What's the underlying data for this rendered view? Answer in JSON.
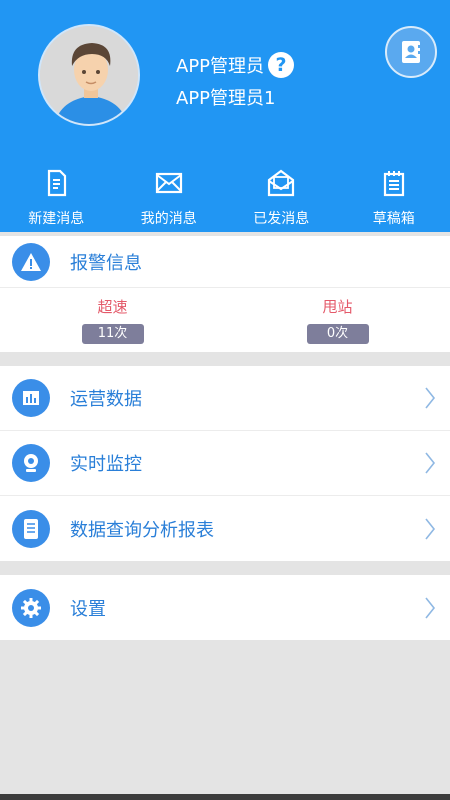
{
  "user": {
    "name_primary": "APP管理员",
    "name_secondary": "APP管理员1"
  },
  "quick_actions": [
    {
      "label": "新建消息",
      "icon": "new-message-icon"
    },
    {
      "label": "我的消息",
      "icon": "envelope-icon"
    },
    {
      "label": "已发消息",
      "icon": "sent-mail-icon"
    },
    {
      "label": "草稿箱",
      "icon": "draft-notepad-icon"
    }
  ],
  "alarm": {
    "title": "报警信息",
    "stats": [
      {
        "label": "超速",
        "count": "11次"
      },
      {
        "label": "甩站",
        "count": "0次"
      }
    ]
  },
  "menu": [
    {
      "label": "运营数据",
      "icon": "bar-chart-icon"
    },
    {
      "label": "实时监控",
      "icon": "webcam-icon"
    },
    {
      "label": "数据查询分析报表",
      "icon": "report-icon"
    }
  ],
  "settings": {
    "label": "设置",
    "icon": "gear-icon"
  },
  "colors": {
    "primary": "#2196f3",
    "accent_blue": "#3a8ee8",
    "alarm_red": "#e45a6a",
    "badge": "#7e7e9b"
  }
}
